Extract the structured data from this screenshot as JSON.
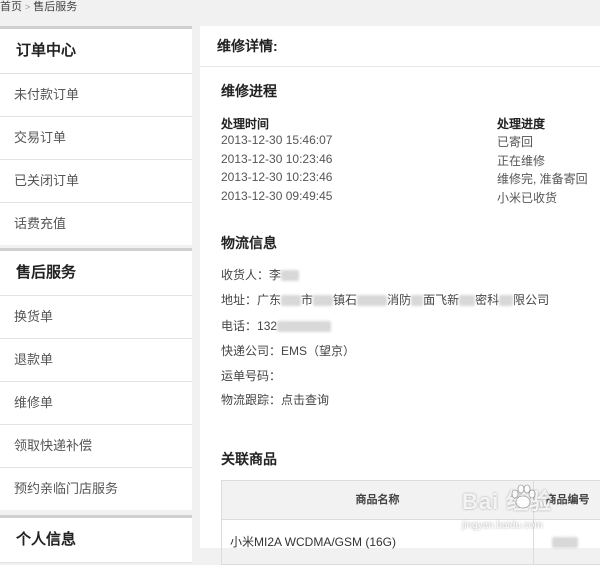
{
  "breadcrumb": {
    "home": "首页",
    "sep": ">",
    "current": "售后服务"
  },
  "sidebar": {
    "order_center": {
      "title": "订单中心",
      "items": [
        "未付款订单",
        "交易订单",
        "已关闭订单",
        "话费充值"
      ]
    },
    "after_sales": {
      "title": "售后服务",
      "items": [
        "换货单",
        "退款单",
        "维修单",
        "领取快递补偿",
        "预约亲临门店服务"
      ]
    },
    "personal": {
      "title": "个人信息"
    }
  },
  "main": {
    "title": "维修详情:",
    "progress": {
      "title": "维修进程",
      "col_time": "处理时间",
      "col_status": "处理进度",
      "rows": [
        {
          "time": "2013-12-30 15:46:07",
          "status": "已寄回"
        },
        {
          "time": "2013-12-30 10:23:46",
          "status": "正在维修"
        },
        {
          "time": "2013-12-30 10:23:46",
          "status": "维修完, 准备寄回"
        },
        {
          "time": "2013-12-30 09:49:45",
          "status": "小米已收货"
        }
      ]
    },
    "logistics": {
      "title": "物流信息",
      "receiver_label": "收货人：",
      "receiver_value": "李",
      "address_label": "地址：",
      "address_parts": [
        "广东",
        "市",
        "镇石",
        "消防",
        "面飞新",
        "密科",
        "限公司"
      ],
      "phone_label": "电话：",
      "phone_value": "132",
      "courier_label": "快递公司：",
      "courier_value": "EMS（望京）",
      "waybill_label": "运单号码：",
      "tracking_label": "物流跟踪：",
      "tracking_link": "点击查询"
    },
    "related": {
      "title": "关联商品",
      "col_name": "商品名称",
      "col_code": "商品编号",
      "rows": [
        {
          "name": "小米MI2A WCDMA/GSM (16G)"
        }
      ]
    }
  },
  "watermark": {
    "brand": "Bai 经验",
    "url": "jingyan.baidu.com"
  }
}
